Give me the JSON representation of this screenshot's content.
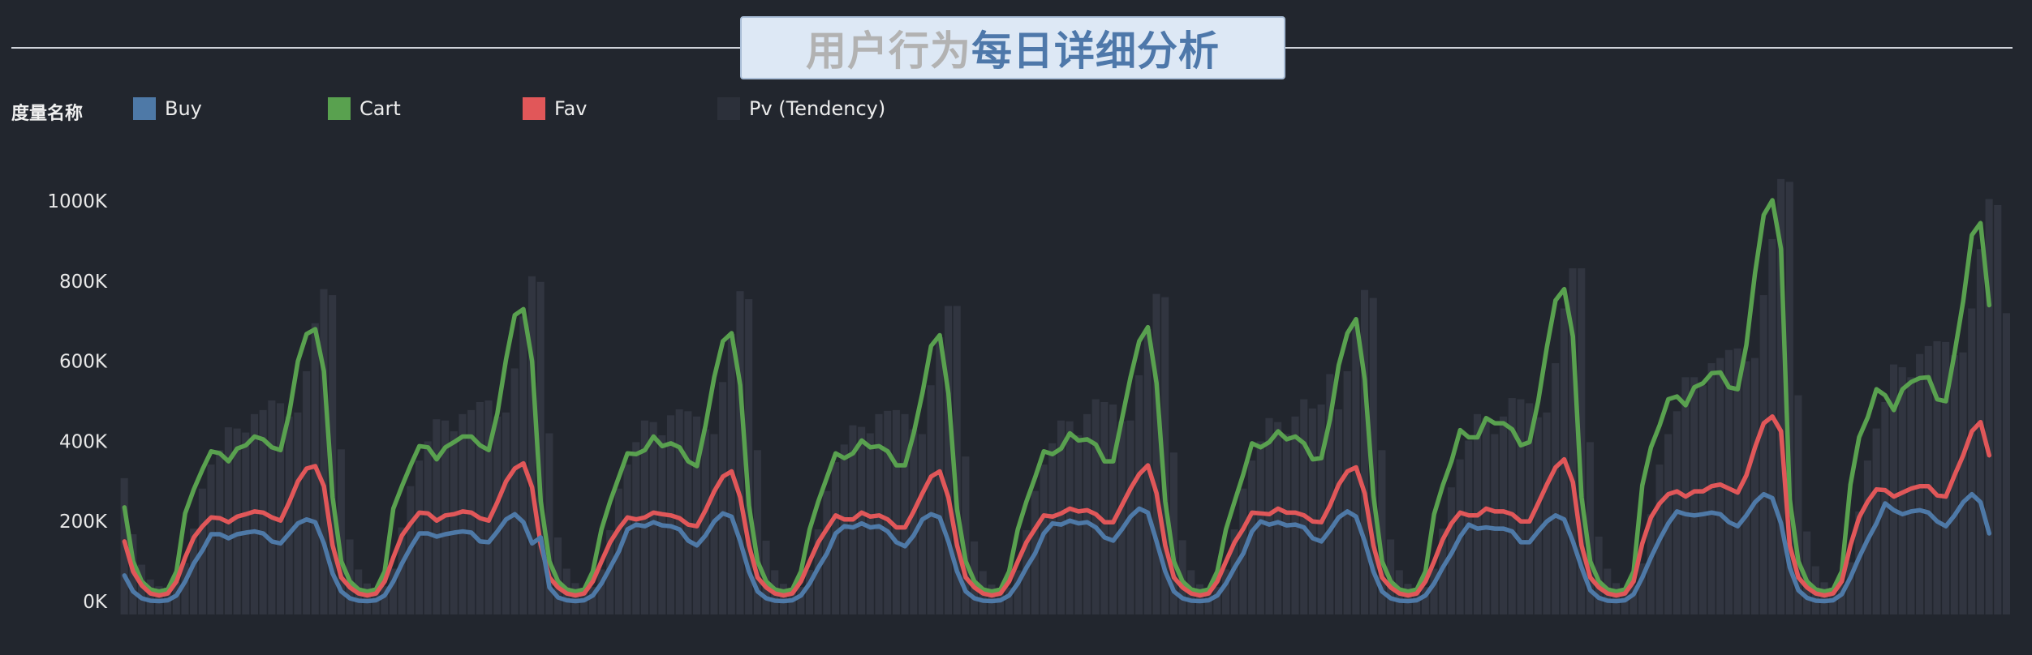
{
  "header": {
    "title_part1": "用户行为",
    "title_part2": "每日详细分析"
  },
  "chart_data": {
    "type": "bar",
    "title": "用户行为每日详细分析",
    "legend": {
      "title": "度量名称",
      "placement": "top-left",
      "items": [
        {
          "label": "Buy",
          "color": "#4e79a7"
        },
        {
          "label": "Cart",
          "color": "#59a14f"
        },
        {
          "label": "Fav",
          "color": "#e15759"
        },
        {
          "label": "Pv (Tendency)",
          "color": "#2c303a"
        }
      ]
    },
    "ylim": [
      0,
      1000000
    ],
    "y_ticks": [
      0,
      200000,
      400000,
      600000,
      800000,
      1000000
    ],
    "y_tick_labels": [
      "0K",
      "200K",
      "400K",
      "600K",
      "800K",
      "1000K"
    ],
    "grid": false,
    "points_per_day": 24,
    "days": 9,
    "series": [
      {
        "name": "Pv (Tendency)",
        "type": "bar",
        "color": "#2c303a",
        "values": [
          308000,
          168000,
          92000,
          55000,
          38000,
          35000,
          48000,
          96000,
          182000,
          282000,
          342000,
          378000,
          435000,
          432000,
          422000,
          468000,
          478000,
          502000,
          495000,
          462000,
          472000,
          575000,
          695000,
          780000,
          765000,
          380000,
          155000,
          80000,
          45000,
          32000,
          38000,
          82000,
          185000,
          288000,
          352000,
          400000,
          455000,
          452000,
          425000,
          468000,
          478000,
          498000,
          502000,
          462000,
          472000,
          582000,
          712000,
          812000,
          798000,
          420000,
          160000,
          82000,
          46000,
          33000,
          36000,
          80000,
          178000,
          282000,
          342000,
          398000,
          452000,
          448000,
          415000,
          465000,
          480000,
          475000,
          462000,
          430000,
          418000,
          548000,
          668000,
          775000,
          755000,
          378000,
          152000,
          78000,
          44000,
          32000,
          36000,
          79000,
          180000,
          276000,
          348000,
          392000,
          440000,
          436000,
          420000,
          468000,
          476000,
          478000,
          468000,
          430000,
          418000,
          540000,
          660000,
          738000,
          738000,
          362000,
          150000,
          76000,
          42000,
          31000,
          35000,
          78000,
          178000,
          276000,
          342000,
          395000,
          452000,
          450000,
          415000,
          468000,
          505000,
          498000,
          492000,
          450000,
          452000,
          565000,
          680000,
          768000,
          760000,
          372000,
          153000,
          78000,
          43000,
          31000,
          36000,
          80000,
          180000,
          282000,
          352000,
          400000,
          458000,
          448000,
          418000,
          462000,
          505000,
          482000,
          492000,
          568000,
          480000,
          575000,
          692000,
          778000,
          758000,
          378000,
          155000,
          78000,
          44000,
          31000,
          36000,
          82000,
          182000,
          285000,
          355000,
          402000,
          468000,
          458000,
          418000,
          462000,
          508000,
          505000,
          495000,
          460000,
          472000,
          595000,
          732000,
          832000,
          832000,
          398000,
          162000,
          82000,
          46000,
          33000,
          40000,
          95000,
          218000,
          342000,
          418000,
          475000,
          560000,
          560000,
          540000,
          595000,
          608000,
          628000,
          632000,
          600000,
          608000,
          765000,
          905000,
          1055000,
          1048000,
          515000,
          175000,
          88000,
          48000,
          35000,
          42000,
          98000,
          225000,
          352000,
          432000,
          498000,
          592000,
          585000,
          560000,
          618000,
          638000,
          650000,
          648000,
          615000,
          622000,
          732000,
          880000,
          1005000,
          990000,
          720000
        ]
      },
      {
        "name": "Cart",
        "type": "line",
        "color": "#59a14f",
        "values": [
          235000,
          100000,
          50000,
          30000,
          25000,
          30000,
          75000,
          220000,
          280000,
          330000,
          375000,
          370000,
          350000,
          382000,
          390000,
          412000,
          405000,
          385000,
          378000,
          470000,
          600000,
          668000,
          680000,
          575000,
          260000,
          100000,
          50000,
          30000,
          25000,
          30000,
          75000,
          232000,
          288000,
          340000,
          388000,
          385000,
          355000,
          385000,
          398000,
          412000,
          412000,
          390000,
          378000,
          470000,
          605000,
          715000,
          730000,
          600000,
          250000,
          100000,
          50000,
          30000,
          25000,
          30000,
          75000,
          180000,
          250000,
          310000,
          370000,
          368000,
          378000,
          412000,
          388000,
          395000,
          385000,
          350000,
          338000,
          440000,
          560000,
          650000,
          670000,
          540000,
          240000,
          100000,
          50000,
          30000,
          25000,
          30000,
          75000,
          180000,
          250000,
          310000,
          370000,
          358000,
          370000,
          402000,
          385000,
          388000,
          375000,
          340000,
          340000,
          420000,
          520000,
          638000,
          665000,
          520000,
          230000,
          100000,
          50000,
          30000,
          25000,
          30000,
          75000,
          180000,
          250000,
          310000,
          375000,
          368000,
          382000,
          420000,
          402000,
          405000,
          392000,
          350000,
          350000,
          455000,
          560000,
          650000,
          685000,
          545000,
          250000,
          100000,
          50000,
          30000,
          25000,
          30000,
          75000,
          180000,
          250000,
          318000,
          395000,
          385000,
          398000,
          425000,
          405000,
          412000,
          395000,
          355000,
          358000,
          455000,
          590000,
          670000,
          705000,
          555000,
          265000,
          100000,
          50000,
          30000,
          25000,
          30000,
          75000,
          218000,
          290000,
          350000,
          428000,
          410000,
          410000,
          458000,
          445000,
          445000,
          430000,
          390000,
          398000,
          500000,
          635000,
          752000,
          780000,
          662000,
          260000,
          100000,
          50000,
          30000,
          25000,
          30000,
          75000,
          290000,
          385000,
          440000,
          505000,
          512000,
          490000,
          535000,
          545000,
          570000,
          572000,
          535000,
          530000,
          640000,
          820000,
          965000,
          1002000,
          880000,
          255000,
          100000,
          50000,
          30000,
          25000,
          30000,
          75000,
          292000,
          410000,
          460000,
          530000,
          515000,
          478000,
          530000,
          548000,
          558000,
          560000,
          505000,
          500000,
          620000,
          750000,
          915000,
          945000,
          740000
        ]
      },
      {
        "name": "Fav",
        "type": "line",
        "color": "#e15759",
        "values": [
          150000,
          75000,
          40000,
          20000,
          15000,
          20000,
          50000,
          110000,
          160000,
          188000,
          210000,
          208000,
          198000,
          212000,
          218000,
          225000,
          222000,
          210000,
          202000,
          248000,
          300000,
          332000,
          338000,
          288000,
          140000,
          60000,
          35000,
          20000,
          15000,
          20000,
          50000,
          110000,
          165000,
          195000,
          222000,
          220000,
          202000,
          215000,
          218000,
          225000,
          222000,
          208000,
          202000,
          248000,
          300000,
          332000,
          345000,
          285000,
          140000,
          60000,
          35000,
          20000,
          15000,
          20000,
          50000,
          100000,
          148000,
          182000,
          210000,
          205000,
          210000,
          222000,
          218000,
          215000,
          208000,
          192000,
          188000,
          228000,
          275000,
          312000,
          325000,
          260000,
          140000,
          60000,
          35000,
          20000,
          15000,
          20000,
          50000,
          100000,
          148000,
          182000,
          215000,
          205000,
          205000,
          222000,
          212000,
          215000,
          205000,
          185000,
          185000,
          225000,
          270000,
          312000,
          325000,
          260000,
          140000,
          60000,
          35000,
          20000,
          15000,
          20000,
          50000,
          100000,
          148000,
          182000,
          215000,
          212000,
          220000,
          232000,
          225000,
          228000,
          218000,
          198000,
          198000,
          240000,
          282000,
          318000,
          340000,
          270000,
          140000,
          60000,
          35000,
          20000,
          15000,
          20000,
          50000,
          100000,
          148000,
          182000,
          222000,
          220000,
          218000,
          232000,
          222000,
          222000,
          215000,
          200000,
          198000,
          240000,
          292000,
          325000,
          335000,
          270000,
          140000,
          60000,
          35000,
          20000,
          15000,
          20000,
          50000,
          100000,
          155000,
          195000,
          222000,
          215000,
          215000,
          232000,
          225000,
          225000,
          218000,
          200000,
          200000,
          245000,
          292000,
          335000,
          355000,
          298000,
          140000,
          60000,
          35000,
          20000,
          15000,
          20000,
          50000,
          145000,
          210000,
          245000,
          268000,
          275000,
          262000,
          275000,
          275000,
          288000,
          292000,
          282000,
          272000,
          315000,
          385000,
          445000,
          462000,
          425000,
          140000,
          60000,
          35000,
          20000,
          15000,
          20000,
          50000,
          140000,
          210000,
          250000,
          280000,
          278000,
          262000,
          272000,
          282000,
          288000,
          288000,
          265000,
          262000,
          315000,
          365000,
          425000,
          448000,
          365000
        ]
      },
      {
        "name": "Buy",
        "type": "line",
        "color": "#4e79a7",
        "values": [
          65000,
          25000,
          8000,
          2000,
          1000,
          3000,
          15000,
          50000,
          95000,
          128000,
          168000,
          168000,
          158000,
          168000,
          172000,
          175000,
          170000,
          150000,
          145000,
          170000,
          195000,
          205000,
          198000,
          145000,
          70000,
          25000,
          8000,
          2000,
          1000,
          3000,
          15000,
          50000,
          95000,
          135000,
          170000,
          170000,
          162000,
          168000,
          172000,
          175000,
          172000,
          150000,
          148000,
          175000,
          205000,
          218000,
          198000,
          145000,
          160000,
          35000,
          10000,
          3000,
          1000,
          3000,
          15000,
          45000,
          85000,
          125000,
          180000,
          192000,
          188000,
          198000,
          190000,
          188000,
          180000,
          152000,
          140000,
          165000,
          200000,
          220000,
          212000,
          150000,
          75000,
          25000,
          8000,
          2000,
          1000,
          3000,
          15000,
          45000,
          85000,
          120000,
          170000,
          188000,
          185000,
          195000,
          185000,
          188000,
          175000,
          148000,
          138000,
          165000,
          205000,
          218000,
          210000,
          150000,
          75000,
          25000,
          8000,
          2000,
          1000,
          3000,
          15000,
          45000,
          85000,
          120000,
          170000,
          195000,
          192000,
          202000,
          195000,
          198000,
          185000,
          160000,
          152000,
          180000,
          212000,
          232000,
          222000,
          150000,
          75000,
          25000,
          8000,
          2000,
          1000,
          3000,
          15000,
          45000,
          85000,
          120000,
          175000,
          200000,
          192000,
          198000,
          190000,
          192000,
          185000,
          158000,
          150000,
          178000,
          210000,
          225000,
          212000,
          150000,
          75000,
          25000,
          8000,
          2000,
          1000,
          3000,
          15000,
          45000,
          85000,
          120000,
          162000,
          192000,
          182000,
          185000,
          182000,
          182000,
          175000,
          148000,
          148000,
          175000,
          200000,
          215000,
          205000,
          150000,
          85000,
          28000,
          9000,
          2000,
          1000,
          3000,
          18000,
          60000,
          110000,
          155000,
          195000,
          225000,
          218000,
          215000,
          218000,
          222000,
          218000,
          198000,
          188000,
          215000,
          248000,
          268000,
          258000,
          195000,
          85000,
          28000,
          9000,
          2000,
          1000,
          3000,
          18000,
          60000,
          110000,
          155000,
          195000,
          245000,
          228000,
          218000,
          225000,
          228000,
          222000,
          200000,
          188000,
          215000,
          248000,
          268000,
          248000,
          170000
        ]
      }
    ]
  }
}
